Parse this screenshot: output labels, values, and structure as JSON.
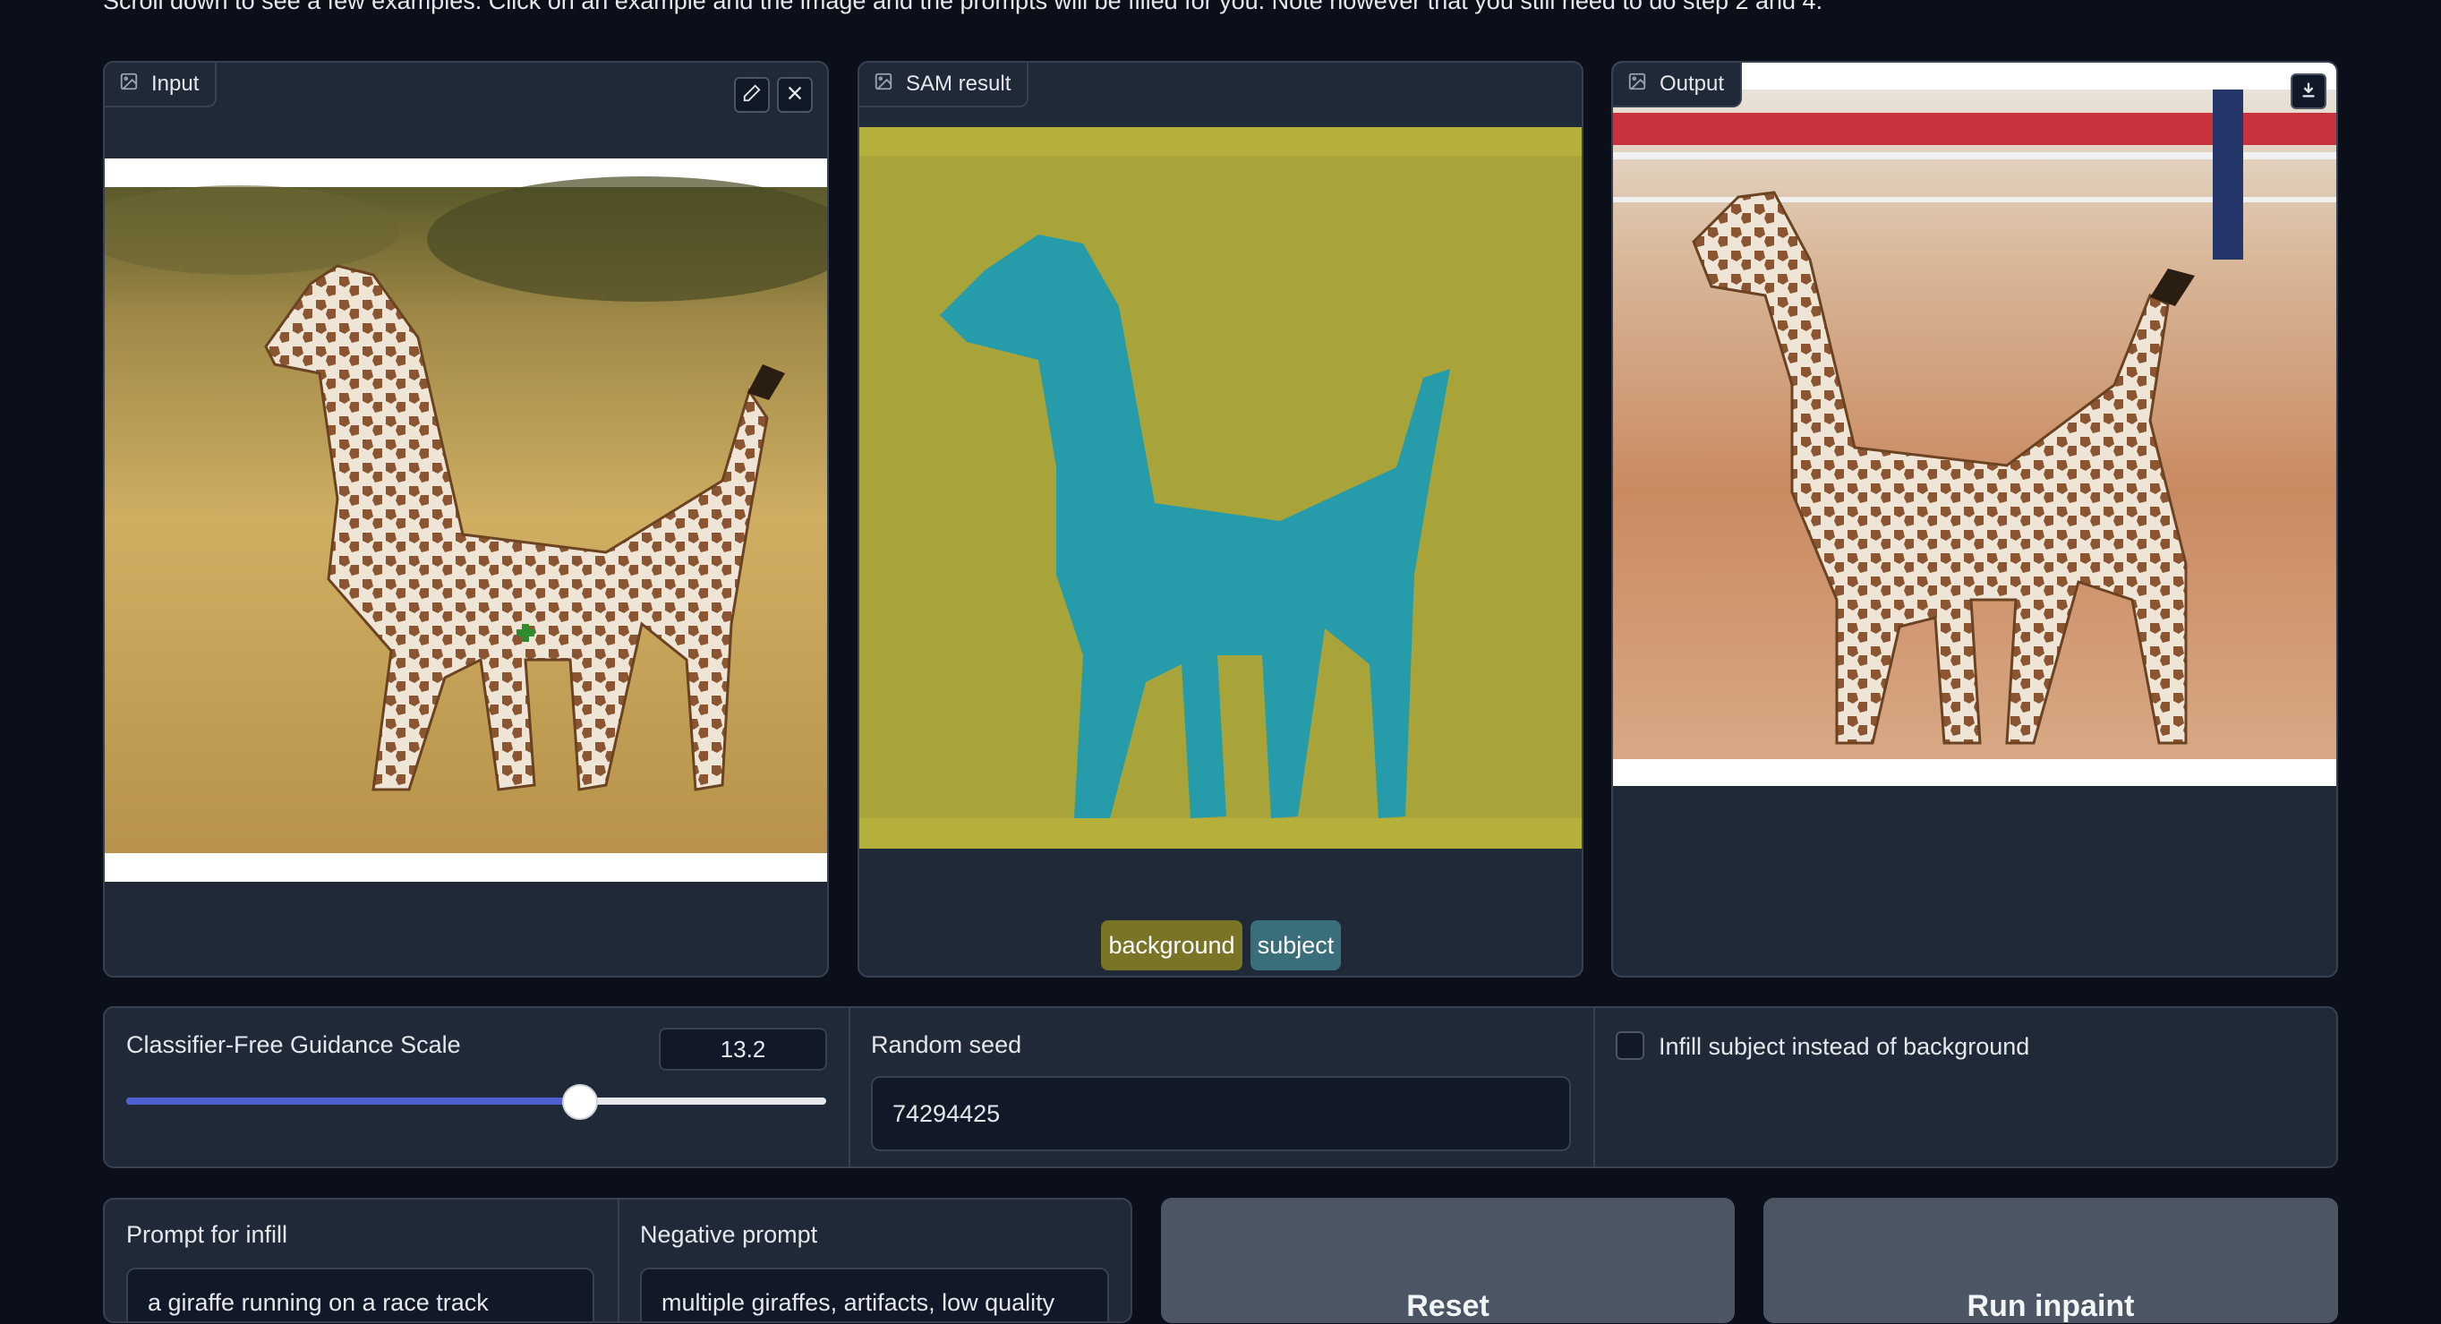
{
  "intro_text": "Scroll down to see a few examples. Click on an example and the image and the prompts will be filled for you. Note however that you still need to do step 2 and 4.",
  "input_panel": {
    "label": "Input",
    "icon": "image-icon",
    "edit_icon": "pencil-icon",
    "close_icon": "close-icon"
  },
  "sam_panel": {
    "label": "SAM result",
    "icon": "image-icon",
    "legend": [
      {
        "label": "background",
        "color": "#7a7426"
      },
      {
        "label": "subject",
        "color": "#3a6e7a"
      }
    ],
    "mask_background_color": "#b5b03c",
    "mask_subject_color": "#1f9bb0"
  },
  "output_panel": {
    "label": "Output",
    "icon": "image-icon",
    "download_icon": "download-icon"
  },
  "guidance": {
    "label": "Classifier-Free Guidance Scale",
    "value": "13.2",
    "fraction": 0.65
  },
  "seed": {
    "label": "Random seed",
    "value": "74294425"
  },
  "infill_subject": {
    "label": "Infill subject instead of background",
    "checked": false
  },
  "prompt": {
    "label": "Prompt for infill",
    "value": "a giraffe running on a race track"
  },
  "negative_prompt": {
    "label": "Negative prompt",
    "value": "multiple giraffes, artifacts, low quality"
  },
  "buttons": {
    "reset": "Reset",
    "run": "Run inpaint"
  },
  "colors": {
    "slider_accent": "#4f5fd1",
    "background": "#0b0f19",
    "panel": "#1f2937"
  }
}
